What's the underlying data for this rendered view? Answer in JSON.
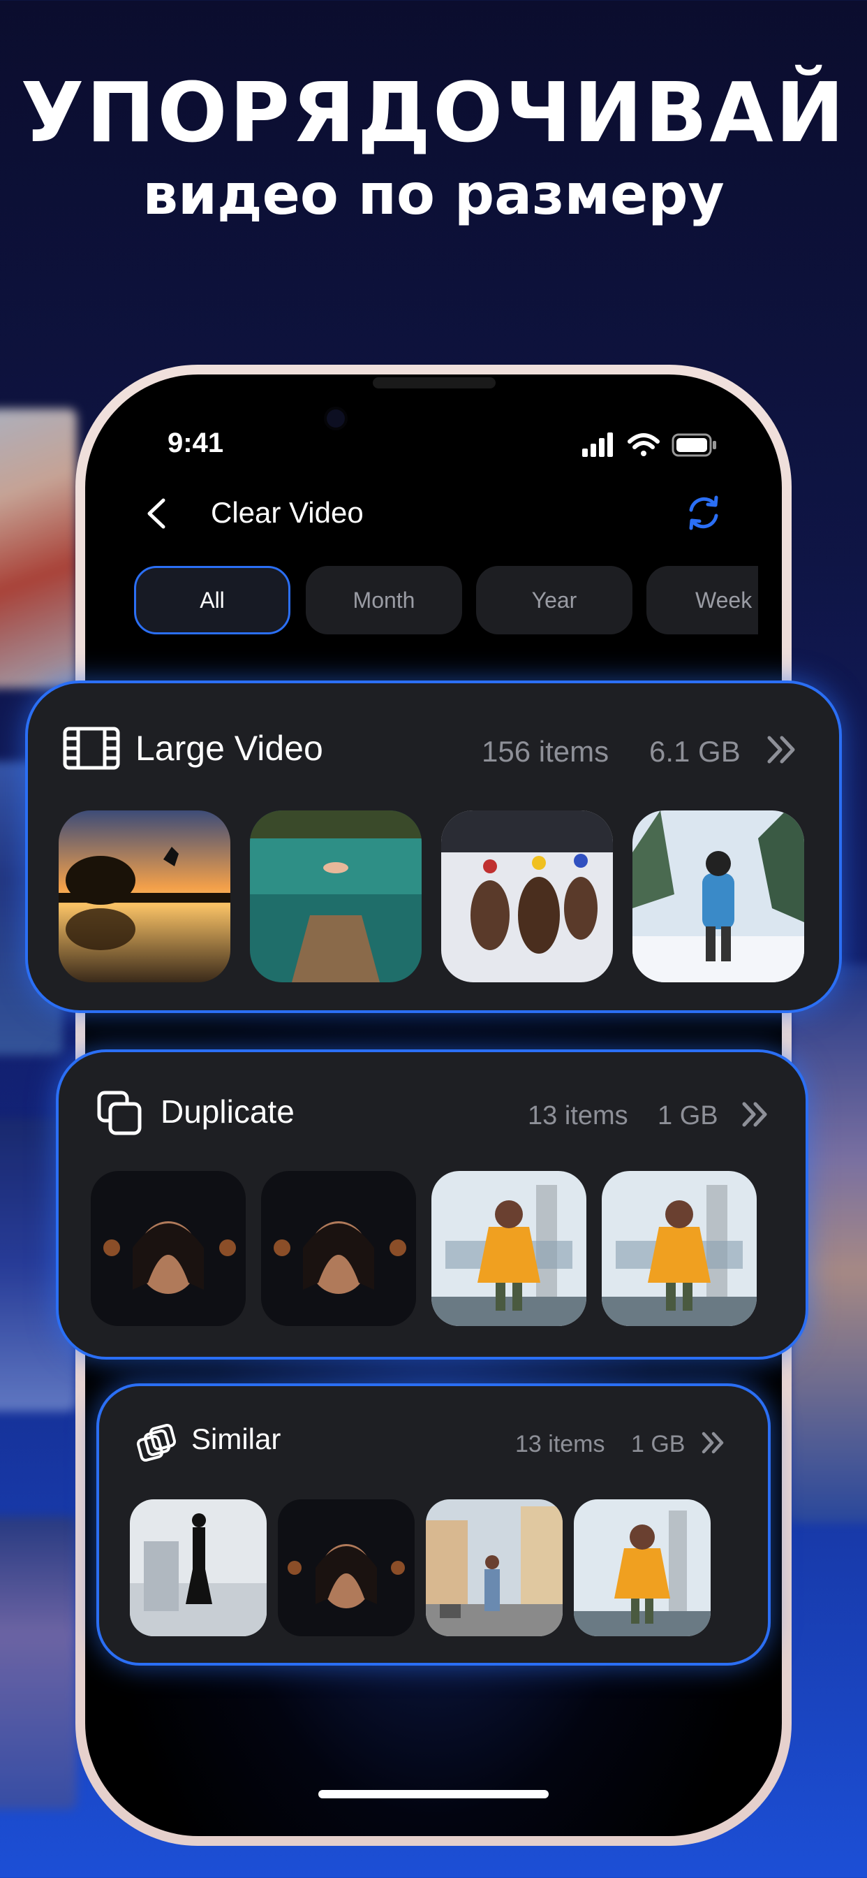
{
  "headline": {
    "title": "УПОРЯДОЧИВАЙ",
    "subtitle": "видео по размеру"
  },
  "status_bar": {
    "time": "9:41",
    "icons": [
      "signal-icon",
      "wifi-icon",
      "battery-icon"
    ]
  },
  "nav": {
    "title": "Clear Video",
    "back_icon": "chevron-left-icon",
    "refresh_icon": "refresh-icon"
  },
  "filters": {
    "selected": "All",
    "items": [
      {
        "label": "All"
      },
      {
        "label": "Month"
      },
      {
        "label": "Year"
      },
      {
        "label": "Week"
      }
    ]
  },
  "sections": [
    {
      "title": "Large Video",
      "count": "156 items",
      "size": "6.1 GB",
      "icon": "film-icon"
    },
    {
      "title": "Duplicate",
      "count": "13 items",
      "size": "1 GB",
      "icon": "duplicate-icon"
    },
    {
      "title": "Similar",
      "count": "13 items",
      "size": "1 GB",
      "icon": "similar-icon"
    }
  ],
  "colors": {
    "accent": "#2b6ff5",
    "card_bg": "#1e1f23",
    "meta_text": "#8e9098",
    "chip_bg": "#1d1e22"
  }
}
